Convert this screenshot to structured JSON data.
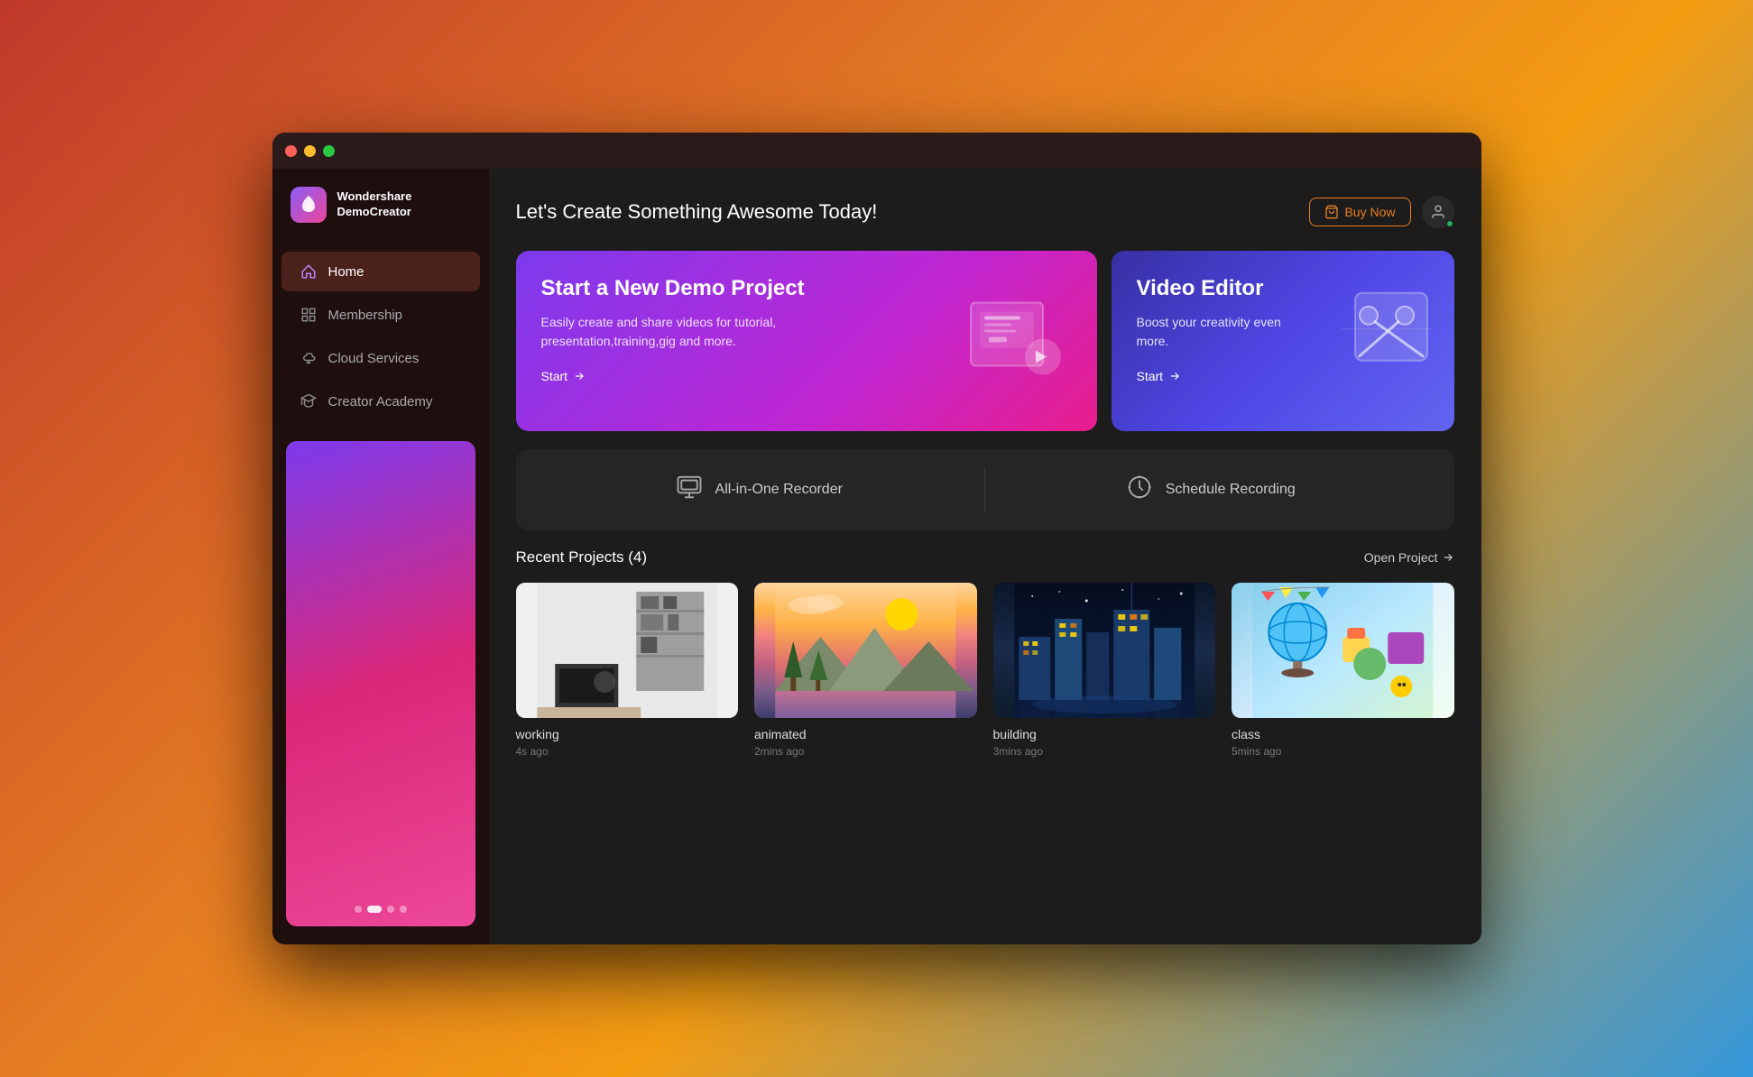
{
  "window": {
    "title": "Wondershare DemoCreator"
  },
  "header": {
    "greeting": "Let's Create Something Awesome Today!",
    "buy_now": "Buy Now"
  },
  "sidebar": {
    "logo_text_line1": "Wondershare",
    "logo_text_line2": "DemoCreator",
    "nav_items": [
      {
        "id": "home",
        "label": "Home",
        "icon": "home",
        "active": true
      },
      {
        "id": "membership",
        "label": "Membership",
        "icon": "grid",
        "active": false
      },
      {
        "id": "cloud-services",
        "label": "Cloud Services",
        "icon": "cloud",
        "active": false
      },
      {
        "id": "creator-academy",
        "label": "Creator Academy",
        "icon": "graduation",
        "active": false
      }
    ]
  },
  "cards": {
    "demo_project": {
      "title": "Start a New Demo Project",
      "description": "Easily create and share videos for tutorial, presentation,training,gig and more.",
      "start_label": "Start"
    },
    "video_editor": {
      "title": "Video Editor",
      "description": "Boost your creativity even more.",
      "start_label": "Start"
    }
  },
  "recorder": {
    "all_in_one_label": "All-in-One Recorder",
    "schedule_label": "Schedule Recording"
  },
  "recent_projects": {
    "title": "Recent Projects (4)",
    "open_project_label": "Open Project",
    "items": [
      {
        "name": "working",
        "time": "4s ago",
        "thumb": "working"
      },
      {
        "name": "animated",
        "time": "2mins ago",
        "thumb": "animated"
      },
      {
        "name": "building",
        "time": "3mins ago",
        "thumb": "building"
      },
      {
        "name": "class",
        "time": "5mins ago",
        "thumb": "class"
      }
    ]
  }
}
